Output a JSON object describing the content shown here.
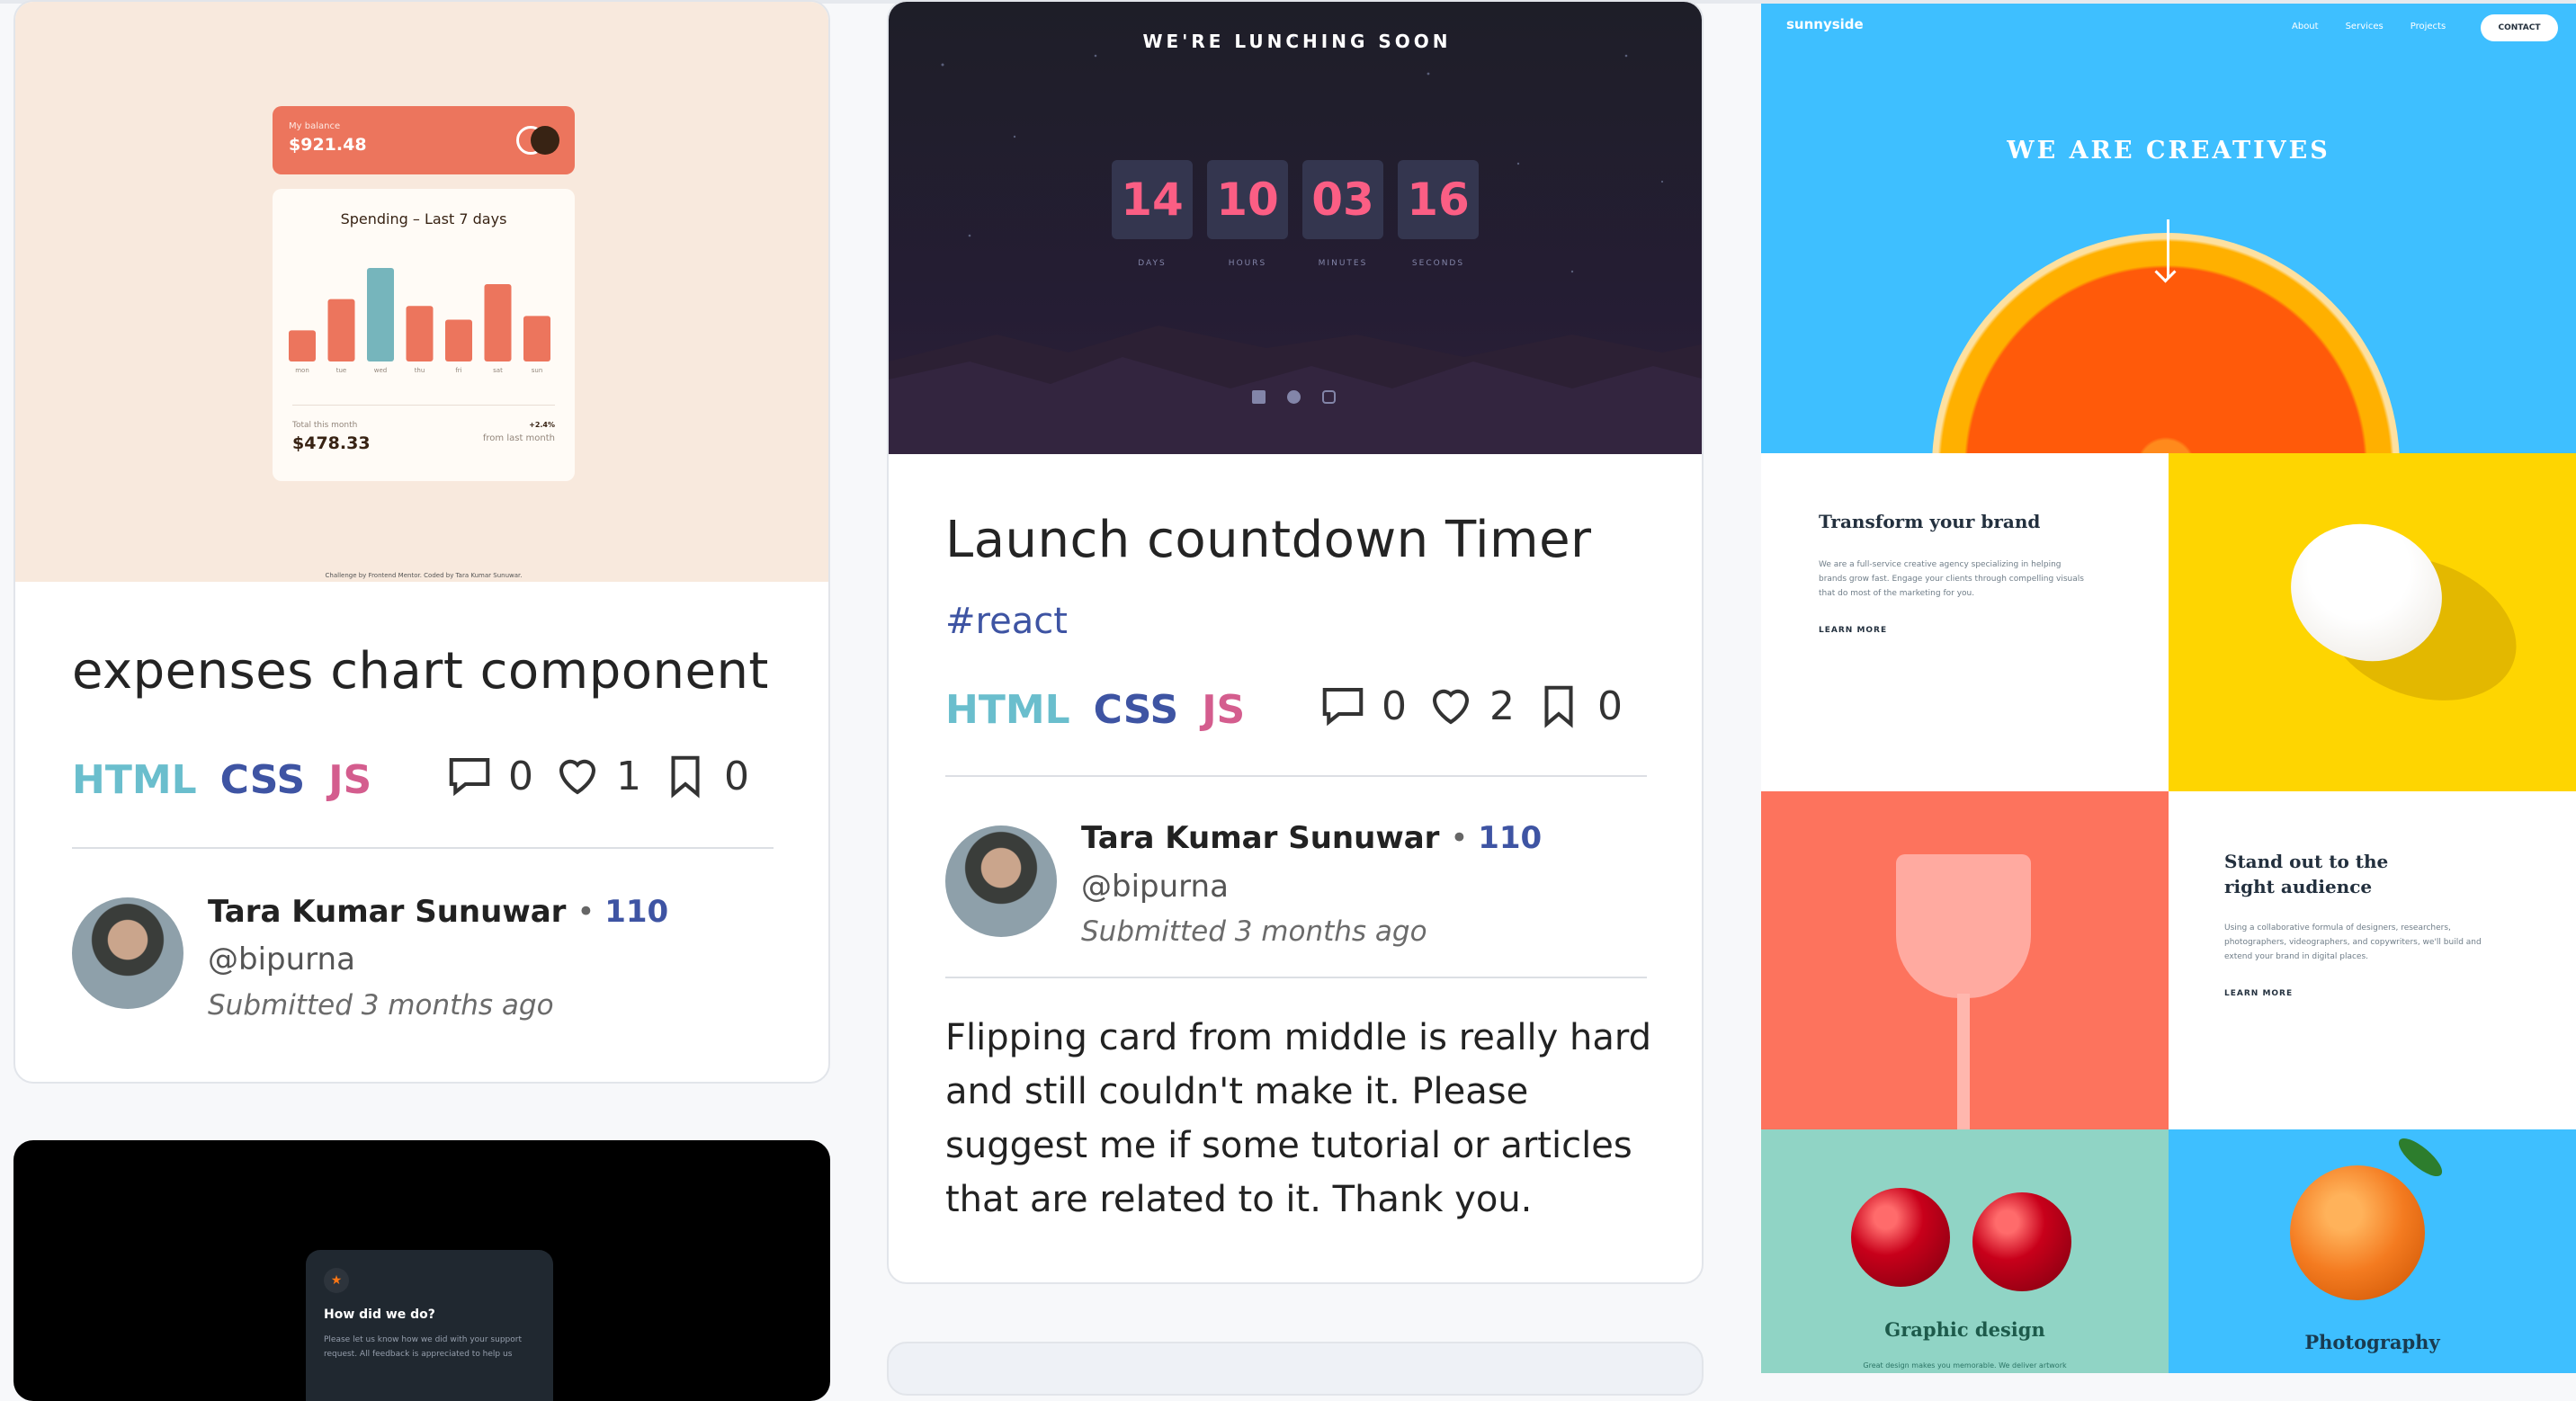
{
  "cards": [
    {
      "title": "expenses chart component",
      "tags": [
        "HTML",
        "CSS",
        "JS"
      ],
      "stats": {
        "comments": "0",
        "likes": "1",
        "bookmarks": "0"
      },
      "author": {
        "name": "Tara Kumar Sunuwar",
        "score": "110",
        "handle": "@bipurna",
        "submitted": "Submitted 3 months ago"
      },
      "preview": {
        "balance_label": "My balance",
        "balance_value": "$921.48",
        "chart_heading": "Spending – Last 7 days",
        "chart_data": {
          "type": "bar",
          "categories": [
            "mon",
            "tue",
            "wed",
            "thu",
            "fri",
            "sat",
            "sun"
          ],
          "values": [
            17.45,
            34.91,
            52.36,
            31.07,
            23.39,
            43.28,
            25.48
          ],
          "highlight_index": 2,
          "colors": {
            "bar": "#ec755d",
            "highlight": "#76b5bc"
          }
        },
        "total_label": "Total this month",
        "total_value": "$478.33",
        "change_value": "+2.4%",
        "change_label": "from last month",
        "footer": "Challenge by Frontend Mentor. Coded by Tara Kumar Sunuwar."
      }
    },
    {
      "title": "Launch countdown Timer",
      "hashtag": "#react",
      "tags": [
        "HTML",
        "CSS",
        "JS"
      ],
      "stats": {
        "comments": "0",
        "likes": "2",
        "bookmarks": "0"
      },
      "author": {
        "name": "Tara Kumar Sunuwar",
        "score": "110",
        "handle": "@bipurna",
        "submitted": "Submitted 3 months ago"
      },
      "description": "Flipping card from middle is really hard and still couldn't make it. Please suggest me if some tutorial or articles that are related to it. Thank you.",
      "preview": {
        "heading": "WE'RE LUNCHING SOON",
        "timer": [
          {
            "value": "14",
            "label": "DAYS"
          },
          {
            "value": "10",
            "label": "HOURS"
          },
          {
            "value": "03",
            "label": "MINUTES"
          },
          {
            "value": "16",
            "label": "SECONDS"
          }
        ],
        "social_icons": [
          "facebook-icon",
          "pinterest-icon",
          "instagram-icon"
        ]
      }
    },
    {
      "preview": {
        "logo": "sunnyside",
        "nav": [
          "About",
          "Services",
          "Projects"
        ],
        "contact": "CONTACT",
        "hero": "WE ARE CREATIVES",
        "block1_title": "Transform your brand",
        "block1_text": "We are a full-service creative agency specializing in helping brands grow fast. Engage your clients through compelling visuals that do most of the marketing for you.",
        "block1_link": "LEARN MORE",
        "block2_title": "Stand out to the right audience",
        "block2_text": "Using a collaborative formula of designers, researchers, photographers, videographers, and copywriters, we'll build and extend your brand in digital places.",
        "block2_link": "LEARN MORE",
        "tile1_title": "Graphic design",
        "tile1_text": "Great design makes you memorable. We deliver artwork",
        "tile2_title": "Photography"
      }
    },
    {
      "preview": {
        "heading": "How did we do?",
        "text": "Please let us know how we did with your support request. All feedback is appreciated to help us"
      }
    }
  ]
}
